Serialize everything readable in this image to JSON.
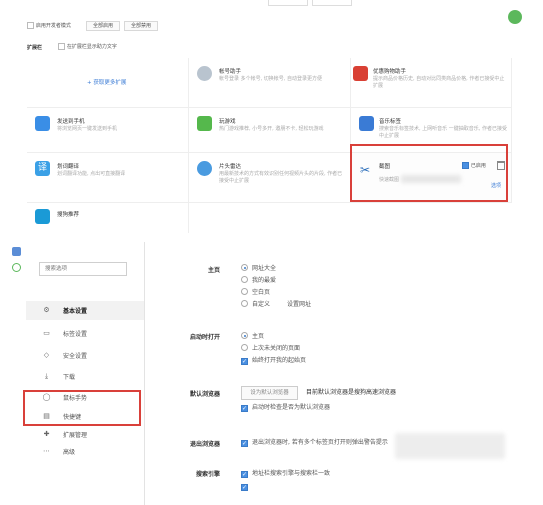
{
  "extensions_page": {
    "toolbar": {
      "dev_mode_label": "启用开发者模式",
      "enable_all_label": "全部启用",
      "disable_all_label": "全部禁用"
    },
    "section_label": "扩展栏",
    "show_text_label": "在扩展栏显示助力文字",
    "get_more_label": "+ 获取更多扩展",
    "extensions": [
      {
        "title": "帐号助手",
        "desc": "帐号登录 多个帐号, 切换帐号, 自动登录更方便",
        "icon": "key-icon",
        "color": "#b9c4cf"
      },
      {
        "title": "优惠购物助手",
        "desc": "提示商品价格历史, 自动对比同类商品价格, 作者已接受中止扩展",
        "icon": "shopping-icon",
        "color": "#d94034"
      },
      {
        "title": "发送到手机",
        "desc": "将浏览网页一键发送到手机",
        "icon": "phone-icon",
        "color": "#3a8ee6"
      },
      {
        "title": "玩游戏",
        "desc": "热门游戏推荐, 小号多开, 邀朋不卡, 轻松玩游戏",
        "icon": "gamepad-icon",
        "color": "#55b84c"
      },
      {
        "title": "音乐标签",
        "desc": "搜索音乐标签技术, 上网听音乐 一键抽取音乐, 作者已接受中止扩展",
        "icon": "music-icon",
        "color": "#3a7bd5"
      },
      {
        "title": "划词翻译",
        "desc": "划词翻译功能, 点出可直接翻译",
        "icon": "translate-icon",
        "color": "#3aa0e6"
      },
      {
        "title": "片头雷达",
        "desc": "用最新技术的方式有效识别任何视频片头的片段, 作者已接受中止扩展",
        "icon": "radar-icon",
        "color": "#4a9be0"
      },
      {
        "title": "截图",
        "desc": "快速截图",
        "icon": "scissors-icon",
        "color": "#2c6fbb",
        "enabled_label": "已启用",
        "options_label": "选项"
      },
      {
        "title": "搜狗推荐",
        "desc": "",
        "icon": "search-icon",
        "color": "#1a9ad6"
      }
    ]
  },
  "settings_page": {
    "search_placeholder": "搜索选项",
    "nav": [
      {
        "label": "基本设置",
        "icon": "gear-icon",
        "active": true
      },
      {
        "label": "标签设置",
        "icon": "tab-icon",
        "active": false
      },
      {
        "label": "安全设置",
        "icon": "shield-icon",
        "active": false
      },
      {
        "label": "下载",
        "icon": "download-icon",
        "active": false
      },
      {
        "label": "鼠标手势",
        "icon": "mouse-icon",
        "active": false
      },
      {
        "label": "快捷键",
        "icon": "keyboard-icon",
        "active": false
      },
      {
        "label": "扩展管理",
        "icon": "puzzle-icon",
        "active": false
      },
      {
        "label": "高级",
        "icon": "more-icon",
        "active": false
      }
    ],
    "homepage": {
      "label": "主页",
      "options": [
        "网址大全",
        "我的最爱",
        "空白页",
        "自定义"
      ],
      "selected": 0,
      "set_url_label": "设置网址"
    },
    "startup": {
      "label": "启动时打开",
      "options": [
        "主页",
        "上次未关闭的页面"
      ],
      "selected": 0,
      "checkbox_label": "始终打开我的起始页"
    },
    "default_browser": {
      "label": "默认浏览器",
      "button_label": "设为默认浏览器",
      "status_text": "目前默认浏览器是搜狗高速浏览器",
      "checkbox_label": "启动时检查是否为默认浏览器"
    },
    "exit_browser": {
      "label": "退出浏览器",
      "checkbox_label": "退出浏览器时, 若有多个标签页打开则弹出警告提示"
    },
    "search_engine": {
      "label": "搜索引擎",
      "checkbox_label": "地址栏搜索引擎与搜索栏一致"
    }
  }
}
